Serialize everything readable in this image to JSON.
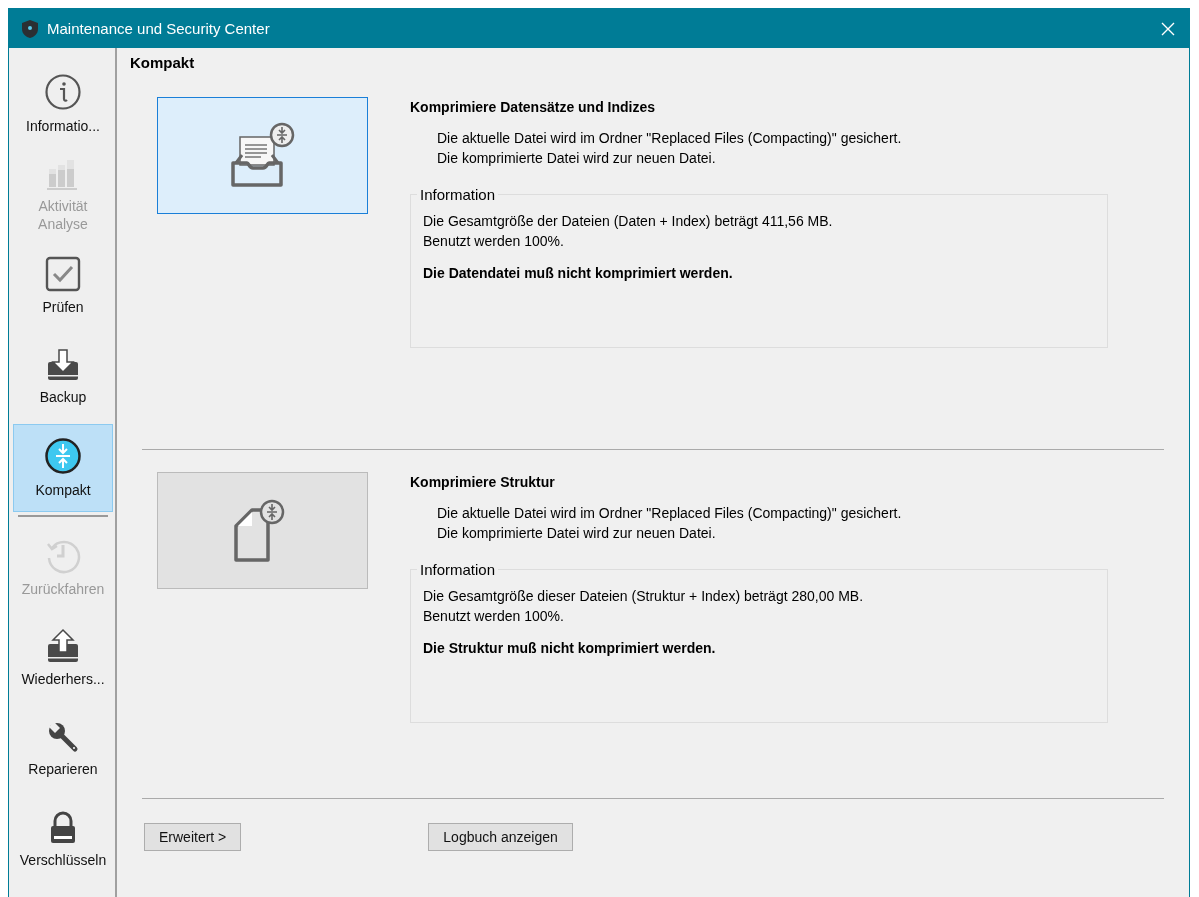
{
  "window": {
    "title": "Maintenance und Security Center"
  },
  "sidebar": {
    "groups": [
      [
        {
          "label": "Informatio...",
          "selected": false,
          "disabled": false
        },
        {
          "label": "Aktivität Analyse",
          "selected": false,
          "disabled": true
        },
        {
          "label": "Prüfen",
          "selected": false,
          "disabled": false
        },
        {
          "label": "Backup",
          "selected": false,
          "disabled": false
        },
        {
          "label": "Kompakt",
          "selected": true,
          "disabled": false
        }
      ],
      [
        {
          "label": "Zurückfahren",
          "selected": false,
          "disabled": true
        },
        {
          "label": "Wiederhers...",
          "selected": false,
          "disabled": false
        },
        {
          "label": "Reparieren",
          "selected": false,
          "disabled": false
        },
        {
          "label": "Verschlüsseln",
          "selected": false,
          "disabled": false
        }
      ]
    ]
  },
  "page_title": "Kompakt",
  "sections": [
    {
      "title": "Komprimiere Datensätze und Indizes",
      "selected": true,
      "lines": [
        "Die aktuelle Datei wird im Ordner \"Replaced Files (Compacting)\" gesichert.",
        "Die komprimierte Datei wird zur neuen Datei."
      ],
      "info": {
        "legend": "Information",
        "lines": [
          "Die Gesamtgröße der Dateien (Daten + Index) beträgt 411,56 MB.",
          "Benutzt werden 100%."
        ],
        "message": "Die Datendatei muß nicht komprimiert werden."
      }
    },
    {
      "title": "Komprimiere Struktur",
      "selected": false,
      "lines": [
        "Die aktuelle Datei wird im Ordner \"Replaced Files (Compacting)\" gesichert.",
        "Die komprimierte Datei wird zur neuen Datei."
      ],
      "info": {
        "legend": "Information",
        "lines": [
          "Die Gesamtgröße dieser Dateien (Struktur + Index) beträgt 280,00 MB.",
          "Benutzt werden 100%."
        ],
        "message": "Die Struktur muß nicht komprimiert werden."
      }
    }
  ],
  "buttons": [
    "Erweitert >",
    "Logbuch anzeigen"
  ]
}
